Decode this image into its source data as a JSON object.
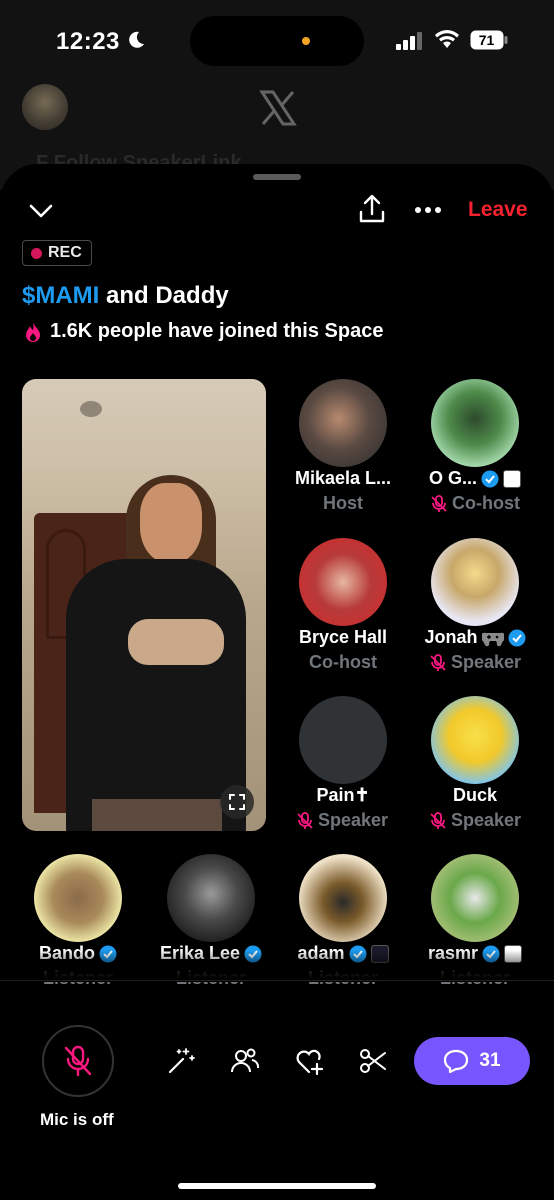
{
  "status_bar": {
    "time": "12:23",
    "battery": "71"
  },
  "background": {
    "faded_text": "F          Follow       SpeakerLink"
  },
  "header": {
    "leave_label": "Leave"
  },
  "space": {
    "rec_label": "REC",
    "title_highlight": "$MAMI",
    "title_rest": " and Daddy",
    "joined_text": "1.6K people have joined this Space"
  },
  "participants": [
    {
      "name": "Mikaela L...",
      "role": "Host",
      "muted": false
    },
    {
      "name": "O G...",
      "role": "Co-host",
      "muted": true
    },
    {
      "name": "Bryce Hall",
      "role": "Co-host",
      "muted": false
    },
    {
      "name": "Jonah",
      "role": "Speaker",
      "muted": true
    },
    {
      "name": "Pain✝",
      "role": "Speaker",
      "muted": true
    },
    {
      "name": "Duck",
      "role": "Speaker",
      "muted": true
    },
    {
      "name": "Bando",
      "role": "Listener"
    },
    {
      "name": "Erika Lee",
      "role": "Listener"
    },
    {
      "name": "adam",
      "role": "Listener"
    },
    {
      "name": "rasmr",
      "role": "Listener"
    }
  ],
  "bottom_bar": {
    "mic_label": "Mic is off",
    "comment_count": "31",
    "tools": [
      "magic-wand-icon",
      "people-icon",
      "heart-plus-icon",
      "scissors-icon"
    ]
  },
  "colors": {
    "accent_blue": "#1d9bf0",
    "leave_red": "#f4212e",
    "comment_purple": "#7856ff",
    "muted_pink": "#f91880"
  }
}
